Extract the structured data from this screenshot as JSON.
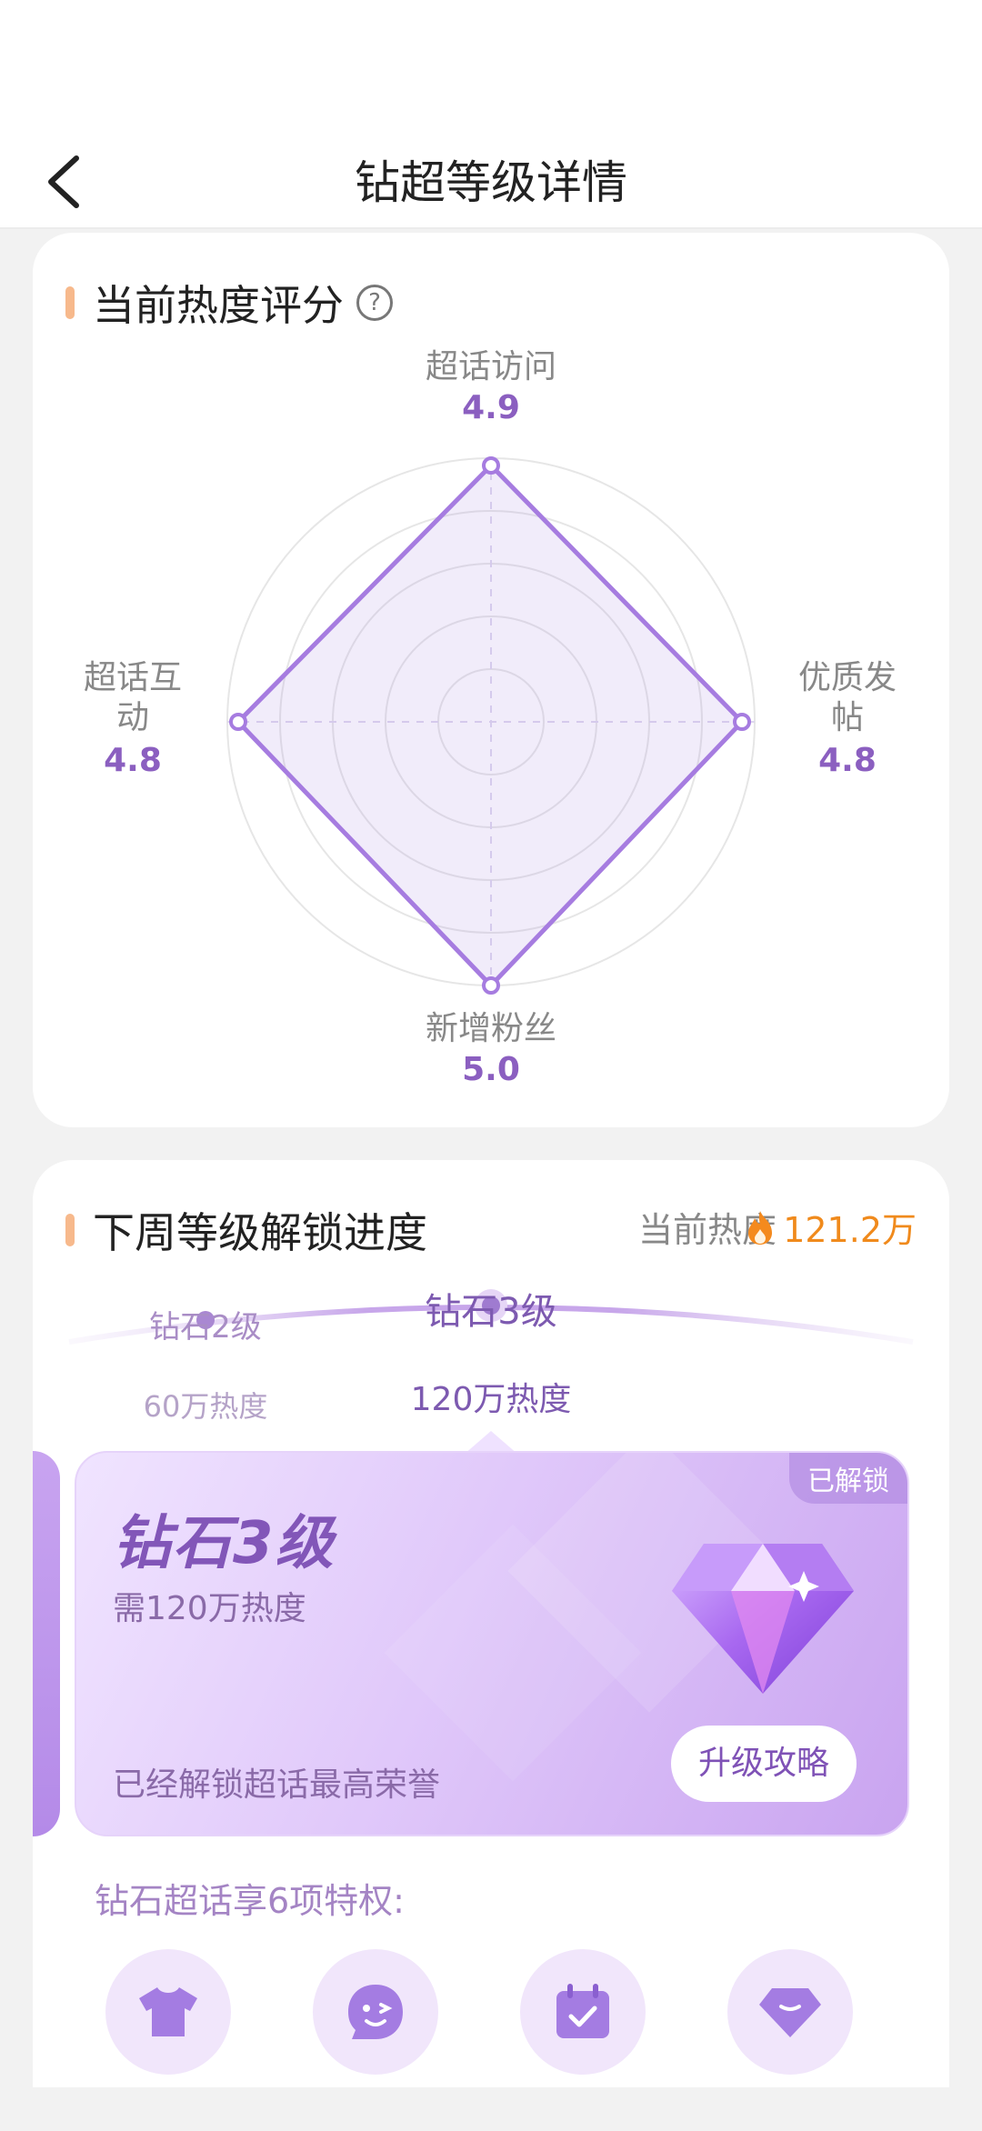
{
  "nav": {
    "title": "钻超等级详情"
  },
  "score_section": {
    "title": "当前热度评分",
    "help_symbol": "?",
    "axes": [
      {
        "label": "超话访问",
        "value": "4.9"
      },
      {
        "label": "优质发帖",
        "value": "4.8"
      },
      {
        "label": "新增粉丝",
        "value": "5.0"
      },
      {
        "label": "超话互动",
        "value": "4.8"
      }
    ],
    "accent": "#9b6fd8"
  },
  "progress_section": {
    "title": "下周等级解锁进度",
    "heat_label": "当前热度",
    "heat_value": "121.2万",
    "levels": [
      {
        "name": "钻石2级",
        "heat": "60万热度"
      },
      {
        "name": "钻石3级",
        "heat": "120万热度"
      }
    ],
    "card": {
      "badge": "已解锁",
      "title": "钻石3级",
      "requirement": "需120万热度",
      "description": "已经解锁超话最高荣誉",
      "button": "升级攻略"
    },
    "privileges_title": "钻石超话享6项特权:",
    "privilege_icons": [
      "shirt-icon",
      "emoji-icon",
      "calendar-check-icon",
      "diamond-icon"
    ]
  }
}
